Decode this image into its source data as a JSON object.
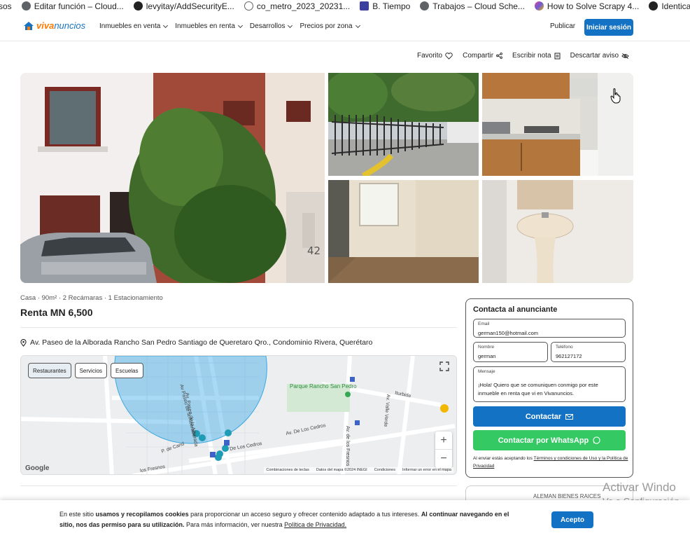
{
  "bookmarks": [
    {
      "label": "sos",
      "color": "#ffffff"
    },
    {
      "label": "Editar función – Cloud...",
      "color": "#5f6368"
    },
    {
      "label": "levyitay/AddSecurityE...",
      "color": "#222222"
    },
    {
      "label": "co_metro_2023_20231...",
      "color": "#5f6368"
    },
    {
      "label": "B. Tiempo",
      "color": "#3c3f9e"
    },
    {
      "label": "Trabajos – Cloud Sche...",
      "color": "#5f6368"
    },
    {
      "label": "How to Solve Scrapy 4...",
      "color": "#e0458b"
    },
    {
      "label": "Identical r",
      "color": "#222222"
    }
  ],
  "header": {
    "logo_part1": "viva",
    "logo_part2": "nuncios",
    "nav": [
      "Inmuebles en venta",
      "Inmuebles en renta",
      "Desarrollos",
      "Precios por zona"
    ],
    "publish": "Publicar",
    "login": "Iniciar sesión"
  },
  "actions": {
    "favorite": "Favorito",
    "share": "Compartir",
    "note": "Escribir nota",
    "discard": "Descartar aviso"
  },
  "listing": {
    "meta": "Casa · 90m² · 2 Recámaras · 1 Estacionamiento",
    "price": "Renta MN 6,500",
    "address": "Av. Paseo de la Alborada Rancho San Pedro Santiago de Queretaro Qro., Condominio Rivera, Querétaro",
    "house_number": "42"
  },
  "map": {
    "filters": [
      "Restaurantes",
      "Servicios",
      "Escuelas"
    ],
    "labels": {
      "park": "Parque Rancho San Pedro",
      "street1": "Av. Paseo de la Alborada",
      "street2": "Av Paseo de la Alborada",
      "street3": "Av. De Los Cedros",
      "street4": "De Los Cedros",
      "street5": "Av. de los Fresnos",
      "street6": "Av. Valle Verde",
      "street7": "Iturbide",
      "street8": "los Fresnos",
      "street9": "P. de Cand"
    },
    "google": "Google",
    "footer": [
      "Combinaciones de teclas",
      "Datos del mapa ©2024 INEGI",
      "Condiciones",
      "Informar un error en el mapa"
    ]
  },
  "contact": {
    "title": "Contacta al anunciante",
    "email_label": "Email",
    "email_value": "german150@hotmail.com",
    "name_label": "Nombre",
    "name_value": "german",
    "phone_label": "Teléfono",
    "phone_value": "962127172",
    "message_label": "Mensaje",
    "message_value": "¡Hola! Quiero que se comuniquen conmigo por este inmueble en renta que vi en Vivanuncios.",
    "contact_button": "Contactar",
    "whatsapp_button": "Contactar por WhatsApp",
    "terms_prefix": "Al enviar estás aceptando los ",
    "terms_link": "Términos y condiciones de Uso y la Política de Privacidad"
  },
  "agency": "ALEMAN BIENES RAICES",
  "windows_activation": {
    "line1": "Activar Windo",
    "line2": "Ve a Configuración"
  },
  "cookie": {
    "p1": "En este sitio ",
    "b1": "usamos y recopilamos cookies",
    "p2": " para proporcionar un acceso seguro y ofrecer contenido adaptado a tus intereses. ",
    "b2": "Al continuar navegando en el sitio, nos das permiso para su utilización.",
    "p3": " Para más información, ver nuestra ",
    "link": "Política de Privacidad.",
    "accept": "Acepto"
  },
  "colors": {
    "primary": "#1472c4",
    "whatsapp": "#35c964",
    "brand_orange": "#ff7a00"
  }
}
